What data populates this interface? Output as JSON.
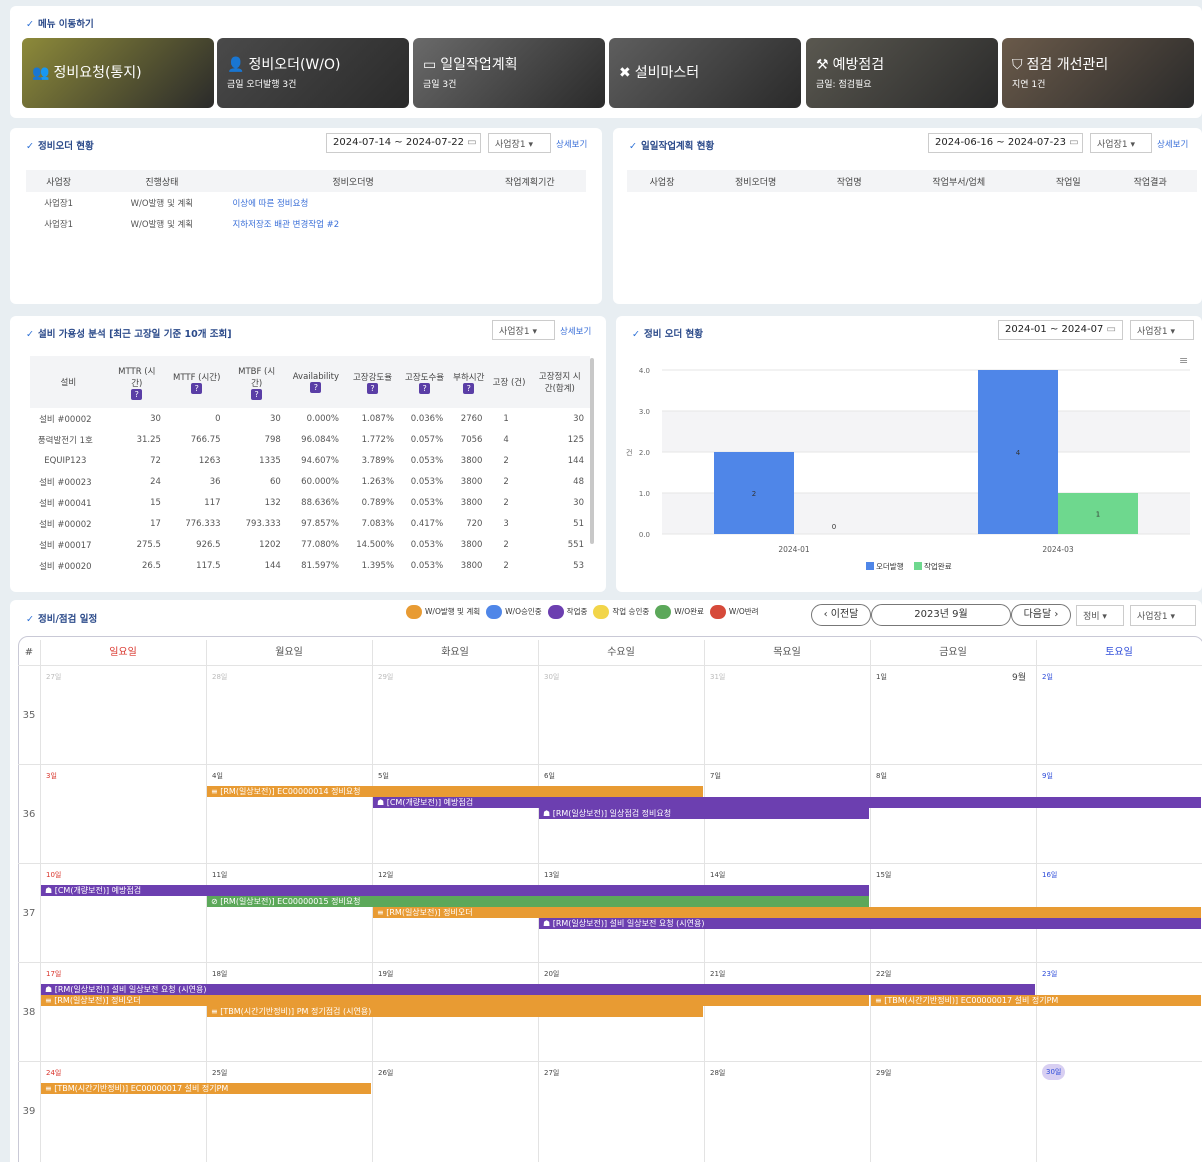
{
  "menu": {
    "title": "메뉴 이동하기",
    "tiles": [
      {
        "title": "정비요청(통지)",
        "sub": "",
        "icon": "users-icon",
        "bg": "#8d8a3a"
      },
      {
        "title": "정비오더(W/O)",
        "sub": "금일 오더발행 3건",
        "icon": "user-gear-icon",
        "bg": "#4a4a4a"
      },
      {
        "title": "일일작업계획",
        "sub": "금일 3건",
        "icon": "calendar-icon",
        "bg": "#6a6a6a"
      },
      {
        "title": "설비마스터",
        "sub": "",
        "icon": "tools-icon",
        "bg": "#5e5e5e"
      },
      {
        "title": "예방점검",
        "sub": "금일: 점검필요",
        "icon": "check-tool-icon",
        "bg": "#5a5850"
      },
      {
        "title": "점검 개선관리",
        "sub": "지연 1건",
        "icon": "shield-icon",
        "bg": "#6a5a4a"
      }
    ]
  },
  "wo_status": {
    "title": "정비오더 현황",
    "date": "2024-07-14 ~ 2024-07-22",
    "site": "사업장1",
    "more": "상세보기",
    "headers": [
      "사업장",
      "진행상태",
      "정비오더명",
      "작업계획기간"
    ],
    "rows": [
      [
        "사업장1",
        "W/O발행 및 계획",
        "이상에 따른 정비요청",
        ""
      ],
      [
        "사업장1",
        "W/O발행 및 계획",
        "지하저장조 배관 변경작업 #2",
        ""
      ]
    ]
  },
  "daily_plan": {
    "title": "일일작업계획 현황",
    "date": "2024-06-16 ~ 2024-07-23",
    "site": "사업장1",
    "more": "상세보기",
    "headers": [
      "사업장",
      "정비오더명",
      "작업명",
      "작업부서/업체",
      "작업일",
      "작업결과"
    ]
  },
  "availability": {
    "title": "설비 가용성 분석 [최근 고장일 기준 10개 조회]",
    "site": "사업장1",
    "more": "상세보기",
    "headers": [
      "설비",
      "MTTR (시간)",
      "MTTF (시간)",
      "MTBF (시간)",
      "Availability",
      "고장강도율",
      "고장도수율",
      "부하시간",
      "고장 (건)",
      "고장정지 시간(합계)"
    ],
    "rows": [
      [
        "설비 #00002",
        "30",
        "0",
        "30",
        "0.000%",
        "1.087%",
        "0.036%",
        "2760",
        "1",
        "30"
      ],
      [
        "풍력발전기 1호",
        "31.25",
        "766.75",
        "798",
        "96.084%",
        "1.772%",
        "0.057%",
        "7056",
        "4",
        "125"
      ],
      [
        "EQUIP123",
        "72",
        "1263",
        "1335",
        "94.607%",
        "3.789%",
        "0.053%",
        "3800",
        "2",
        "144"
      ],
      [
        "설비 #00023",
        "24",
        "36",
        "60",
        "60.000%",
        "1.263%",
        "0.053%",
        "3800",
        "2",
        "48"
      ],
      [
        "설비 #00041",
        "15",
        "117",
        "132",
        "88.636%",
        "0.789%",
        "0.053%",
        "3800",
        "2",
        "30"
      ],
      [
        "설비 #00002",
        "17",
        "776.333",
        "793.333",
        "97.857%",
        "7.083%",
        "0.417%",
        "720",
        "3",
        "51"
      ],
      [
        "설비 #00017",
        "275.5",
        "926.5",
        "1202",
        "77.080%",
        "14.500%",
        "0.053%",
        "3800",
        "2",
        "551"
      ],
      [
        "설비 #00020",
        "26.5",
        "117.5",
        "144",
        "81.597%",
        "1.395%",
        "0.053%",
        "3800",
        "2",
        "53"
      ]
    ]
  },
  "order_chart": {
    "title": "정비 오더 현황",
    "date": "2024-01 ~ 2024-07",
    "site": "사업장1"
  },
  "chart_data": {
    "type": "bar",
    "categories": [
      "2024-01",
      "2024-03"
    ],
    "series": [
      {
        "name": "오더발행",
        "values": [
          2,
          4
        ],
        "color": "#4f86e8"
      },
      {
        "name": "작업완료",
        "values": [
          0,
          1
        ],
        "color": "#6ed88e"
      }
    ],
    "ylabel": "건",
    "ylim": [
      0,
      4
    ],
    "yticks": [
      "0.0",
      "1.0",
      "2.0",
      "3.0",
      "4.0"
    ]
  },
  "calendar": {
    "title": "정비/점검 일정",
    "legend": [
      {
        "label": "W/O발행 및 계획",
        "color": "#e89b33"
      },
      {
        "label": "W/O승인중",
        "color": "#4f86e8"
      },
      {
        "label": "작업중",
        "color": "#6c3fb0"
      },
      {
        "label": "작업 승인중",
        "color": "#f2d54a"
      },
      {
        "label": "W/O완료",
        "color": "#5ca85a"
      },
      {
        "label": "W/O반려",
        "color": "#d64a3a"
      }
    ],
    "prev": "이전달",
    "month": "2023년 9월",
    "next": "다음달",
    "filter1": "정비",
    "filter2": "사업장1",
    "hash": "#",
    "days": [
      "일요일",
      "월요일",
      "화요일",
      "수요일",
      "목요일",
      "금요일",
      "토요일"
    ],
    "month_label": "9월",
    "weeks": [
      {
        "no": "35",
        "dates": [
          "27일",
          "28일",
          "29일",
          "30일",
          "31일",
          "1일",
          "2일"
        ]
      },
      {
        "no": "36",
        "dates": [
          "3일",
          "4일",
          "5일",
          "6일",
          "7일",
          "8일",
          "9일"
        ]
      },
      {
        "no": "37",
        "dates": [
          "10일",
          "11일",
          "12일",
          "13일",
          "14일",
          "15일",
          "16일"
        ]
      },
      {
        "no": "38",
        "dates": [
          "17일",
          "18일",
          "19일",
          "20일",
          "21일",
          "22일",
          "23일"
        ]
      },
      {
        "no": "39",
        "dates": [
          "24일",
          "25일",
          "26일",
          "27일",
          "28일",
          "29일",
          "30일"
        ]
      }
    ],
    "events": [
      {
        "w": 1,
        "s": 1,
        "e": 4,
        "lane": 0,
        "c": "o",
        "t": "≡ [RM(일상보전)] EC00000014 정비요청"
      },
      {
        "w": 1,
        "s": 2,
        "e": 7,
        "lane": 1,
        "c": "p",
        "t": "☗ [CM(개량보전)] 예방점검"
      },
      {
        "w": 1,
        "s": 3,
        "e": 5,
        "lane": 2,
        "c": "p",
        "t": "☗ [RM(일상보전)] 일상점검 정비요청"
      },
      {
        "w": 2,
        "s": 0,
        "e": 5,
        "lane": 0,
        "c": "p",
        "t": "☗ [CM(개량보전)] 예방점검"
      },
      {
        "w": 2,
        "s": 1,
        "e": 5,
        "lane": 1,
        "c": "g",
        "t": "⊘ [RM(일상보전)] EC00000015 정비요청"
      },
      {
        "w": 2,
        "s": 2,
        "e": 7,
        "lane": 2,
        "c": "o",
        "t": "≡ [RM(일상보전)] 정비오더"
      },
      {
        "w": 2,
        "s": 3,
        "e": 7,
        "lane": 3,
        "c": "p",
        "t": "☗ [RM(일상보전)] 설비 일상보전 요청 (시연용)"
      },
      {
        "w": 3,
        "s": 0,
        "e": 6,
        "lane": 0,
        "c": "p",
        "t": "☗ [RM(일상보전)] 설비 일상보전 요청 (시연용)"
      },
      {
        "w": 3,
        "s": 0,
        "e": 5,
        "lane": 1,
        "c": "o",
        "t": "≡ [RM(일상보전)] 정비오더"
      },
      {
        "w": 3,
        "s": 5,
        "e": 7,
        "lane": 1,
        "c": "o",
        "t": "≡ [TBM(시간기반정비)] EC00000017 설비 정기PM"
      },
      {
        "w": 3,
        "s": 1,
        "e": 4,
        "lane": 2,
        "c": "o",
        "t": "≡ [TBM(시간기반정비)] PM 정기점검 (시연용)"
      },
      {
        "w": 4,
        "s": 0,
        "e": 2,
        "lane": 0,
        "c": "o",
        "t": "≡ [TBM(시간기반정비)] EC00000017 설비 정기PM"
      }
    ]
  }
}
